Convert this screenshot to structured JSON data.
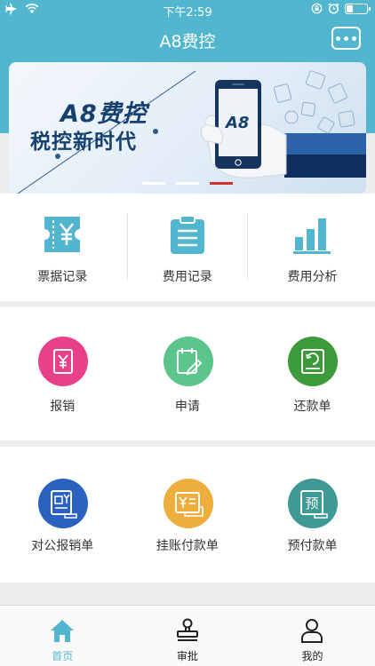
{
  "status": {
    "time": "下午2:59",
    "battery_level": 0.3
  },
  "header": {
    "title": "A8费控",
    "more_icon": "more-dots-icon"
  },
  "banner": {
    "brand": "A8费控",
    "slogan": "税控新时代",
    "phone_logo": "A8",
    "active_slide": 3,
    "slides": 3
  },
  "quick_records": [
    {
      "label": "票据记录",
      "icon": "ticket-yen-icon"
    },
    {
      "label": "费用记录",
      "icon": "clipboard-list-icon"
    },
    {
      "label": "费用分析",
      "icon": "bar-chart-icon"
    }
  ],
  "actions": [
    {
      "label": "报销",
      "icon": "reimburse-icon",
      "color": "#e8418a"
    },
    {
      "label": "申请",
      "icon": "apply-icon",
      "color": "#5bc58c"
    },
    {
      "label": "还款单",
      "icon": "repayment-icon",
      "color": "#3d9a3a"
    }
  ],
  "payments": [
    {
      "label": "对公报销单",
      "icon": "corporate-reimburse-icon",
      "color": "#2b62c0"
    },
    {
      "label": "挂账付款单",
      "icon": "credit-payment-icon",
      "color": "#edae3d"
    },
    {
      "label": "预付款单",
      "icon": "prepayment-icon",
      "color": "#3f9a95",
      "glyph": "预"
    }
  ],
  "tabbar": [
    {
      "label": "首页",
      "icon": "home-icon",
      "active": true
    },
    {
      "label": "审批",
      "icon": "approval-stamp-icon",
      "active": false
    },
    {
      "label": "我的",
      "icon": "profile-icon",
      "active": false
    }
  ],
  "colors": {
    "primary": "#53b6cf",
    "brand_navy": "#16416f",
    "active_dot": "#c9322e"
  }
}
